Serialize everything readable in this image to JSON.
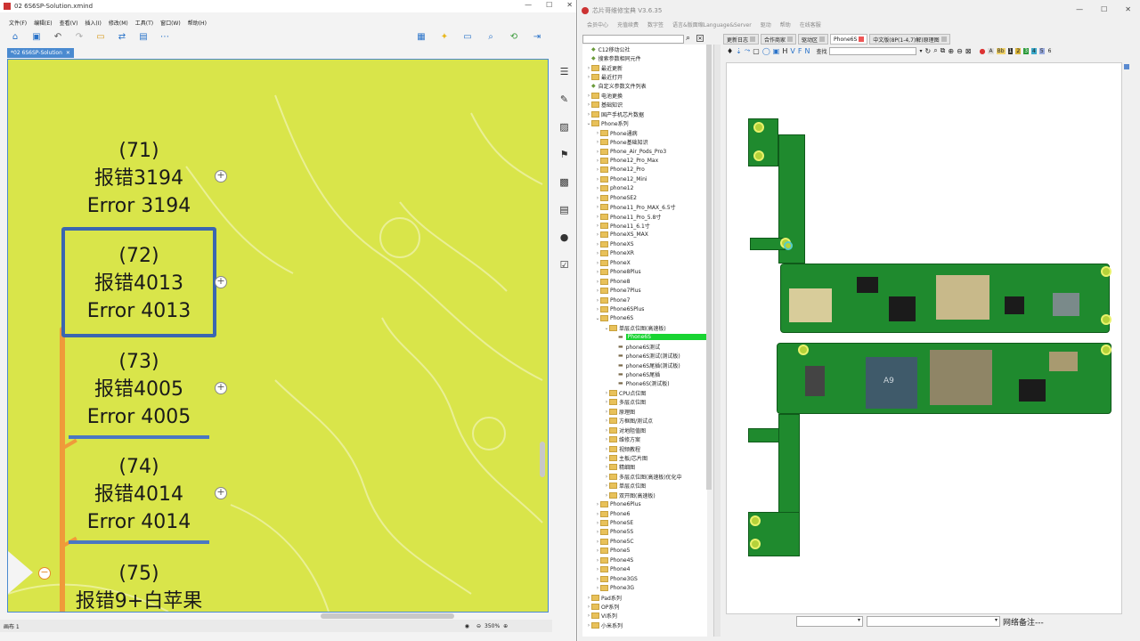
{
  "left_window": {
    "title": "02 6S6SP-Solution.xmind",
    "menu": [
      "文件(F)",
      "编辑(E)",
      "查看(V)",
      "插入(I)",
      "修改(M)",
      "工具(T)",
      "窗口(W)",
      "帮助(H)"
    ],
    "doc_tab": "*02 6S6SP-Solution",
    "topics": [
      {
        "num": "(71)",
        "cn": "报错3194",
        "en": "Error 3194"
      },
      {
        "num": "(72)",
        "cn": "报错4013",
        "en": "Error 4013"
      },
      {
        "num": "(73)",
        "cn": "报错4005",
        "en": "Error 4005"
      },
      {
        "num": "(74)",
        "cn": "报错4014",
        "en": "Error 4014"
      },
      {
        "num": "(75)",
        "cn": "报错9+白苹果",
        "en": ""
      }
    ],
    "status": {
      "sheet": "画布 1",
      "zoom": "350%"
    }
  },
  "right_window": {
    "title": "芯片哥维修宝典 V3.6.35",
    "menu": [
      "会员中心",
      "充值续费",
      "数字签",
      "语言&版面缩Language&Server",
      "驱动",
      "帮助",
      "在线客服"
    ],
    "tabs": [
      {
        "label": "更新日志",
        "active": false
      },
      {
        "label": "合作商家",
        "active": false
      },
      {
        "label": "驱动区",
        "active": false
      },
      {
        "label": "Phone6S",
        "active": true
      },
      {
        "label": "中文版(8P(1-4,7)解)原理图",
        "active": false
      }
    ],
    "search_label": "查找",
    "tree": [
      {
        "label": "C12移动公社",
        "level": 0,
        "type": "item"
      },
      {
        "label": "搜索参数相同元件",
        "level": 0,
        "type": "item"
      },
      {
        "label": "最近更新",
        "level": 0,
        "type": "folder"
      },
      {
        "label": "最近打开",
        "level": 0,
        "type": "folder"
      },
      {
        "label": "自定义参数文件列表",
        "level": 0,
        "type": "item"
      },
      {
        "label": "电池更换",
        "level": 0,
        "type": "folder"
      },
      {
        "label": "基础知识",
        "level": 0,
        "type": "folder"
      },
      {
        "label": "国产手机芯片数据",
        "level": 0,
        "type": "folder"
      },
      {
        "label": "Phone系列",
        "level": 0,
        "type": "folder"
      },
      {
        "label": "Phone通病",
        "level": 1,
        "type": "folder"
      },
      {
        "label": "Phone基础知识",
        "level": 1,
        "type": "folder"
      },
      {
        "label": "Phone_Air_Pods_Pro3",
        "level": 1,
        "type": "folder"
      },
      {
        "label": "Phone12_Pro_Max",
        "level": 1,
        "type": "folder"
      },
      {
        "label": "Phone12_Pro",
        "level": 1,
        "type": "folder"
      },
      {
        "label": "Phone12_Mini",
        "level": 1,
        "type": "folder"
      },
      {
        "label": "phone12",
        "level": 1,
        "type": "folder"
      },
      {
        "label": "PhoneSE2",
        "level": 1,
        "type": "folder"
      },
      {
        "label": "Phone11_Pro_MAX_6.5寸",
        "level": 1,
        "type": "folder"
      },
      {
        "label": "Phone11_Pro_5.8寸",
        "level": 1,
        "type": "folder"
      },
      {
        "label": "Phone11_6.1寸",
        "level": 1,
        "type": "folder"
      },
      {
        "label": "PhoneXS_MAX",
        "level": 1,
        "type": "folder"
      },
      {
        "label": "PhoneXS",
        "level": 1,
        "type": "folder"
      },
      {
        "label": "PhoneXR",
        "level": 1,
        "type": "folder"
      },
      {
        "label": "PhoneX",
        "level": 1,
        "type": "folder"
      },
      {
        "label": "Phone8Plus",
        "level": 1,
        "type": "folder"
      },
      {
        "label": "Phone8",
        "level": 1,
        "type": "folder"
      },
      {
        "label": "Phone7Plus",
        "level": 1,
        "type": "folder"
      },
      {
        "label": "Phone7",
        "level": 1,
        "type": "folder"
      },
      {
        "label": "Phone6SPlus",
        "level": 1,
        "type": "folder"
      },
      {
        "label": "Phone6S",
        "level": 1,
        "type": "folder"
      },
      {
        "label": "单层点位图(高速板)",
        "level": 2,
        "type": "folder"
      },
      {
        "label": "Phone6S",
        "level": 3,
        "type": "selected"
      },
      {
        "label": "phone6S测试",
        "level": 3,
        "type": "file"
      },
      {
        "label": "phone6S测试(测试板)",
        "level": 3,
        "type": "file"
      },
      {
        "label": "phone6S尾插(测试板)",
        "level": 3,
        "type": "file"
      },
      {
        "label": "phone6S尾插",
        "level": 3,
        "type": "file"
      },
      {
        "label": "Phone6S(测试板)",
        "level": 3,
        "type": "file"
      },
      {
        "label": "CPU点位图",
        "level": 2,
        "type": "folder"
      },
      {
        "label": "多层点位图",
        "level": 2,
        "type": "folder"
      },
      {
        "label": "原理图",
        "level": 2,
        "type": "folder"
      },
      {
        "label": "方框图/测试点",
        "level": 2,
        "type": "folder"
      },
      {
        "label": "对地阻值图",
        "level": 2,
        "type": "folder"
      },
      {
        "label": "维修方案",
        "level": 2,
        "type": "folder"
      },
      {
        "label": "视频教程",
        "level": 2,
        "type": "folder"
      },
      {
        "label": "主板/芯片图",
        "level": 2,
        "type": "folder"
      },
      {
        "label": "精细图",
        "level": 2,
        "type": "folder"
      },
      {
        "label": "多层点位图(高速板)优化中",
        "level": 2,
        "type": "folder"
      },
      {
        "label": "单层点位图",
        "level": 2,
        "type": "folder"
      },
      {
        "label": "双开图(高速板)",
        "level": 2,
        "type": "folder"
      },
      {
        "label": "Phone6Plus",
        "level": 1,
        "type": "folder"
      },
      {
        "label": "Phone6",
        "level": 1,
        "type": "folder"
      },
      {
        "label": "PhoneSE",
        "level": 1,
        "type": "folder"
      },
      {
        "label": "Phone5S",
        "level": 1,
        "type": "folder"
      },
      {
        "label": "Phone5C",
        "level": 1,
        "type": "folder"
      },
      {
        "label": "Phone5",
        "level": 1,
        "type": "folder"
      },
      {
        "label": "Phone4S",
        "level": 1,
        "type": "folder"
      },
      {
        "label": "Phone4",
        "level": 1,
        "type": "folder"
      },
      {
        "label": "Phone3GS",
        "level": 1,
        "type": "folder"
      },
      {
        "label": "Phone3G",
        "level": 1,
        "type": "folder"
      },
      {
        "label": "Pad系列",
        "level": 0,
        "type": "folder"
      },
      {
        "label": "OP系列",
        "level": 0,
        "type": "folder"
      },
      {
        "label": "VI系列",
        "level": 0,
        "type": "folder"
      },
      {
        "label": "小米系列",
        "level": 0,
        "type": "folder"
      }
    ],
    "bottom_label": "网络备注---",
    "chip_label": "A9"
  }
}
